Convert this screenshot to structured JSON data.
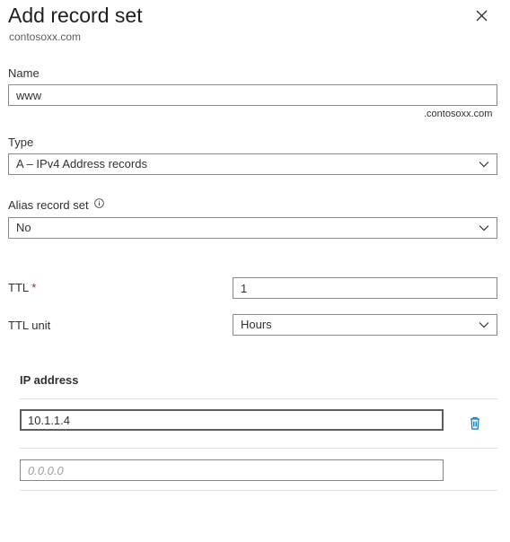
{
  "panel": {
    "title": "Add record set",
    "subtitle": "contosoxx.com"
  },
  "name": {
    "label": "Name",
    "value": "www",
    "suffix": ".contosoxx.com"
  },
  "type": {
    "label": "Type",
    "selected": "A – IPv4 Address records"
  },
  "alias": {
    "label": "Alias record set",
    "selected": "No"
  },
  "ttl": {
    "label": "TTL",
    "required_marker": "*",
    "value": "1"
  },
  "ttl_unit": {
    "label": "TTL unit",
    "selected": "Hours"
  },
  "ip_addresses": {
    "header": "IP address",
    "rows": [
      {
        "value": "10.1.1.4"
      }
    ],
    "new_placeholder": "0.0.0.0"
  },
  "icons": {
    "close": "close-icon",
    "info": "info-icon",
    "chevron": "chevron-down-icon",
    "delete": "trash-icon"
  },
  "colors": {
    "text": "#323130",
    "border": "#8a8886",
    "required": "#a4262c",
    "accent": "#0078d4",
    "separator": "#e1dfdd"
  }
}
